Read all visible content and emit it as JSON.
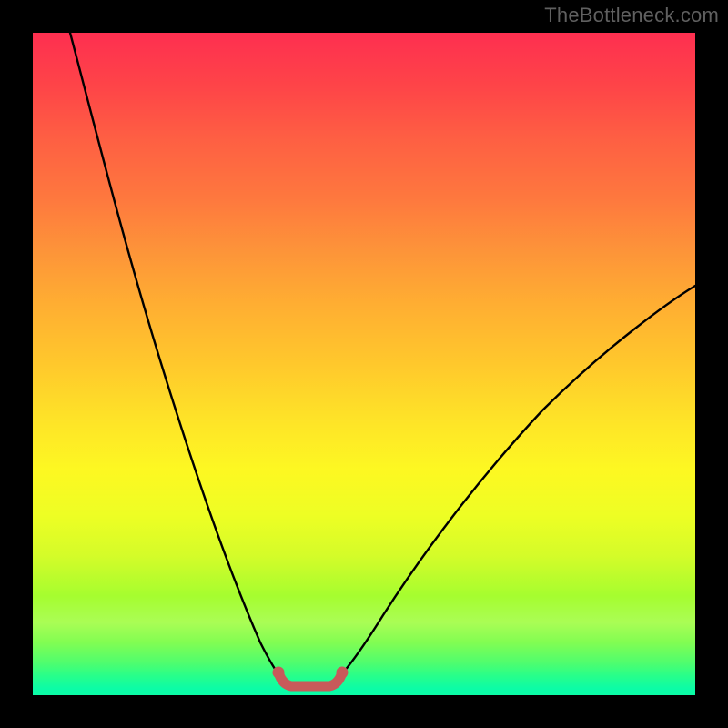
{
  "watermark": "TheBottleneck.com",
  "colors": {
    "page_bg": "#000000",
    "curve_stroke": "#000000",
    "flat_segment": "#c85a5a"
  },
  "chart_data": {
    "type": "line",
    "title": "",
    "xlabel": "",
    "ylabel": "",
    "xlim": [
      0,
      100
    ],
    "ylim": [
      0,
      100
    ],
    "series": [
      {
        "name": "left-arm",
        "x": [
          5,
          10,
          15,
          20,
          25,
          30,
          33,
          36
        ],
        "y": [
          100,
          80,
          60,
          42,
          26,
          13,
          6,
          1
        ]
      },
      {
        "name": "flat-bottom",
        "x": [
          36,
          44
        ],
        "y": [
          0.5,
          0.5
        ]
      },
      {
        "name": "right-arm",
        "x": [
          44,
          50,
          58,
          68,
          80,
          92,
          100
        ],
        "y": [
          1,
          6,
          15,
          27,
          41,
          53,
          60
        ]
      }
    ],
    "annotations": [
      {
        "text": "TheBottleneck.com",
        "pos": "top-right"
      }
    ]
  }
}
